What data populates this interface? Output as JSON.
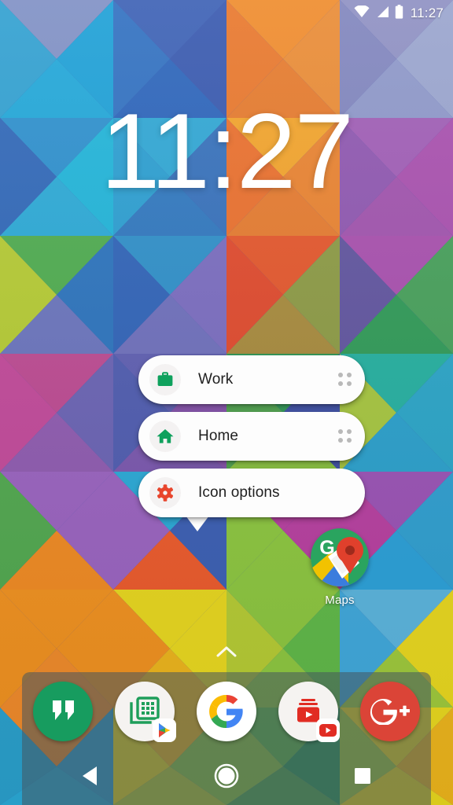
{
  "status_bar": {
    "time": "11:27",
    "icons": [
      "wifi-icon",
      "cellular-signal-icon",
      "battery-icon"
    ]
  },
  "clock_widget": {
    "time": "11:27"
  },
  "shortcut_menu": {
    "items": [
      {
        "label": "Work",
        "icon": "briefcase-icon",
        "icon_color": "#0FA15D",
        "has_drag_handle": true
      },
      {
        "label": "Home",
        "icon": "house-icon",
        "icon_color": "#0FA15D",
        "has_drag_handle": true
      },
      {
        "label": "Icon options",
        "icon": "gear-icon",
        "icon_color": "#E8452C",
        "has_drag_handle": false
      }
    ],
    "background_color": "#fdfdfd"
  },
  "desktop_icon": {
    "label": "Maps",
    "icon": "google-maps-icon"
  },
  "drawer_indicator": {
    "icon": "chevron-up-icon"
  },
  "dock": {
    "items": [
      {
        "label": "Hangouts",
        "icon": "hangouts-icon",
        "color": "#179C5F",
        "badge": null
      },
      {
        "label": "Apps Folder",
        "icon": "apps-grid-icon",
        "color": "#F5F3F1",
        "badge": "play-store-icon"
      },
      {
        "label": "Google",
        "icon": "google-g-icon",
        "color": "#FFFFFF",
        "badge": null
      },
      {
        "label": "YouTube Library",
        "icon": "youtube-stack-icon",
        "color": "#F5F3F1",
        "badge": "youtube-icon"
      },
      {
        "label": "Google Plus",
        "icon": "google-plus-icon",
        "color": "#DB4437",
        "badge": null
      }
    ],
    "background_color": "rgba(70,85,95,.55)"
  },
  "nav_bar": {
    "buttons": [
      {
        "name": "back",
        "icon": "back-triangle-icon"
      },
      {
        "name": "home",
        "icon": "home-circle-icon"
      },
      {
        "name": "recents",
        "icon": "recents-square-icon"
      }
    ]
  },
  "wallpaper": {
    "description": "geometric low-poly triangles",
    "palette": [
      "#1BA8D8",
      "#2B63B5",
      "#3A4E9E",
      "#7C5BC0",
      "#B73FA0",
      "#E8452C",
      "#F07C20",
      "#F5A623",
      "#E8D71E",
      "#8CC63F",
      "#19A559",
      "#16B5A4"
    ]
  }
}
